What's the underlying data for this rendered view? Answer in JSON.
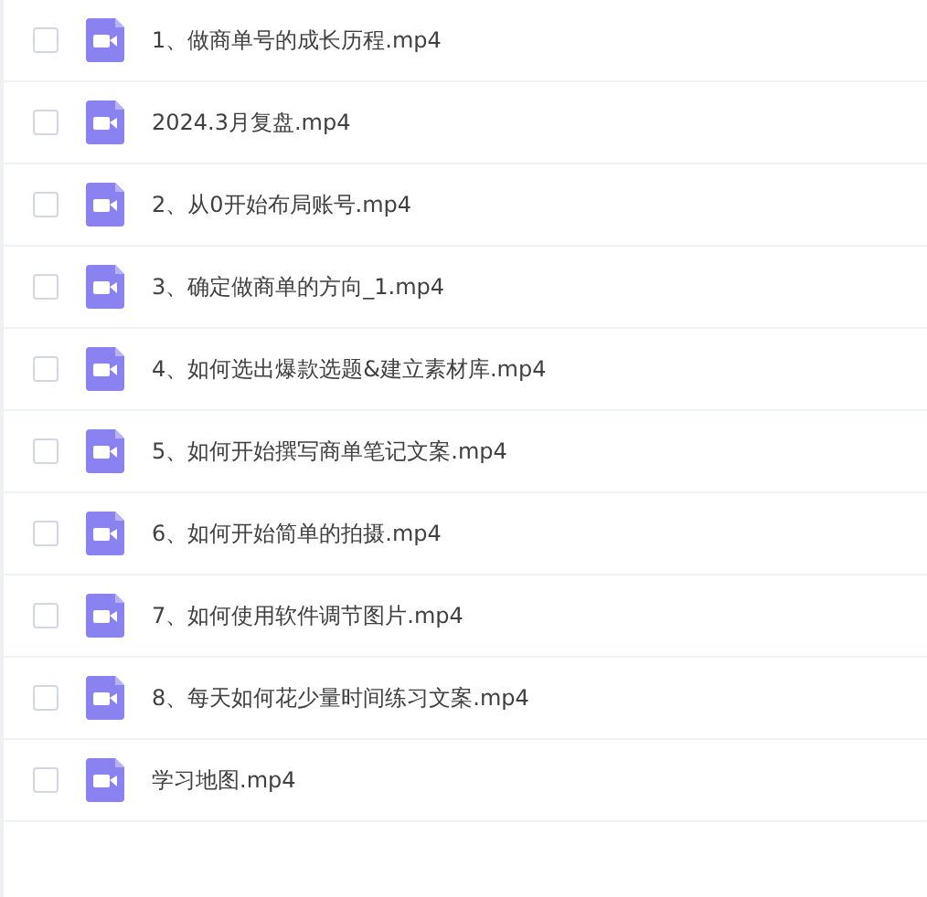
{
  "files": [
    {
      "name": "1、做商单号的成长历程.mp4",
      "checked": false
    },
    {
      "name": "2024.3月复盘.mp4",
      "checked": false
    },
    {
      "name": "2、从0开始布局账号.mp4",
      "checked": false
    },
    {
      "name": "3、确定做商单的方向_1.mp4",
      "checked": false
    },
    {
      "name": "4、如何选出爆款选题&建立素材库.mp4",
      "checked": false
    },
    {
      "name": "5、如何开始撰写商单笔记文案.mp4",
      "checked": false
    },
    {
      "name": "6、如何开始简单的拍摄.mp4",
      "checked": false
    },
    {
      "name": "7、如何使用软件调节图片.mp4",
      "checked": false
    },
    {
      "name": "8、每天如何花少量时间练习文案.mp4",
      "checked": false
    },
    {
      "name": "学习地图.mp4",
      "checked": false
    }
  ]
}
